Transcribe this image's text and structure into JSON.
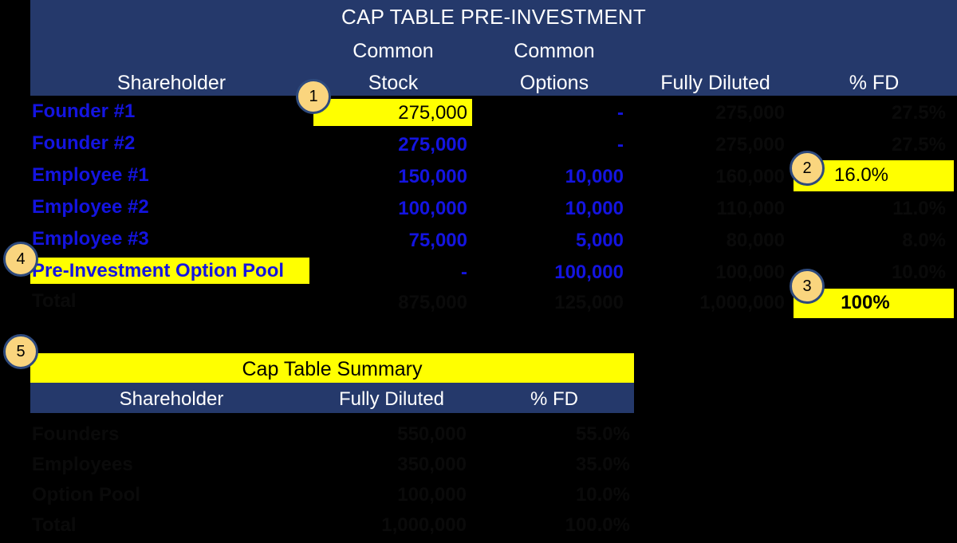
{
  "colors": {
    "header_navy": "#25396B",
    "highlight_yellow": "#FFFF00",
    "value_blue": "#1414E0",
    "badge_fill": "#FAD57E",
    "badge_border": "#2E4A7D",
    "background": "#000000"
  },
  "main_table": {
    "title": "CAP TABLE PRE-INVESTMENT",
    "columns": [
      {
        "line1": "",
        "line2": "Shareholder"
      },
      {
        "line1": "Common",
        "line2": "Stock"
      },
      {
        "line1": "Common",
        "line2": "Options"
      },
      {
        "line1": "",
        "line2": "Fully Diluted"
      },
      {
        "line1": "",
        "line2": "% FD"
      }
    ],
    "rows": [
      {
        "shareholder": "Founder #1",
        "common_stock": "275,000",
        "common_options": "-",
        "fully_diluted": "275,000",
        "pct_fd": "27.5%"
      },
      {
        "shareholder": "Founder #2",
        "common_stock": "275,000",
        "common_options": "-",
        "fully_diluted": "275,000",
        "pct_fd": "27.5%"
      },
      {
        "shareholder": "Employee #1",
        "common_stock": "150,000",
        "common_options": "10,000",
        "fully_diluted": "160,000",
        "pct_fd": "16.0%"
      },
      {
        "shareholder": "Employee #2",
        "common_stock": "100,000",
        "common_options": "10,000",
        "fully_diluted": "110,000",
        "pct_fd": "11.0%"
      },
      {
        "shareholder": "Employee #3",
        "common_stock": "75,000",
        "common_options": "5,000",
        "fully_diluted": "80,000",
        "pct_fd": "8.0%"
      },
      {
        "shareholder": "Pre-Investment Option Pool",
        "common_stock": "-",
        "common_options": "100,000",
        "fully_diluted": "100,000",
        "pct_fd": "10.0%"
      }
    ],
    "total_row": {
      "shareholder": "Total",
      "common_stock": "875,000",
      "common_options": "125,000",
      "fully_diluted": "1,000,000",
      "pct_fd": "100.0%"
    }
  },
  "summary_table": {
    "title": "Cap Table Summary",
    "columns": [
      "Shareholder",
      "Fully Diluted",
      "% FD"
    ],
    "rows": [
      {
        "shareholder": "Founders",
        "fully_diluted": "550,000",
        "pct_fd": "55.0%"
      },
      {
        "shareholder": "Employees",
        "fully_diluted": "350,000",
        "pct_fd": "35.0%"
      },
      {
        "shareholder": "Option Pool",
        "fully_diluted": "100,000",
        "pct_fd": "10.0%"
      },
      {
        "shareholder": "Total",
        "fully_diluted": "1,000,000",
        "pct_fd": "100.0%"
      }
    ]
  },
  "highlights": {
    "founder1_stock": "275,000",
    "employee1_pct": "16.0%",
    "total_pct": "100%",
    "option_pool_label": "Pre-Investment Option Pool",
    "summary_title": "Cap Table Summary"
  },
  "callouts": [
    {
      "number": "1"
    },
    {
      "number": "2"
    },
    {
      "number": "3"
    },
    {
      "number": "4"
    },
    {
      "number": "5"
    }
  ]
}
